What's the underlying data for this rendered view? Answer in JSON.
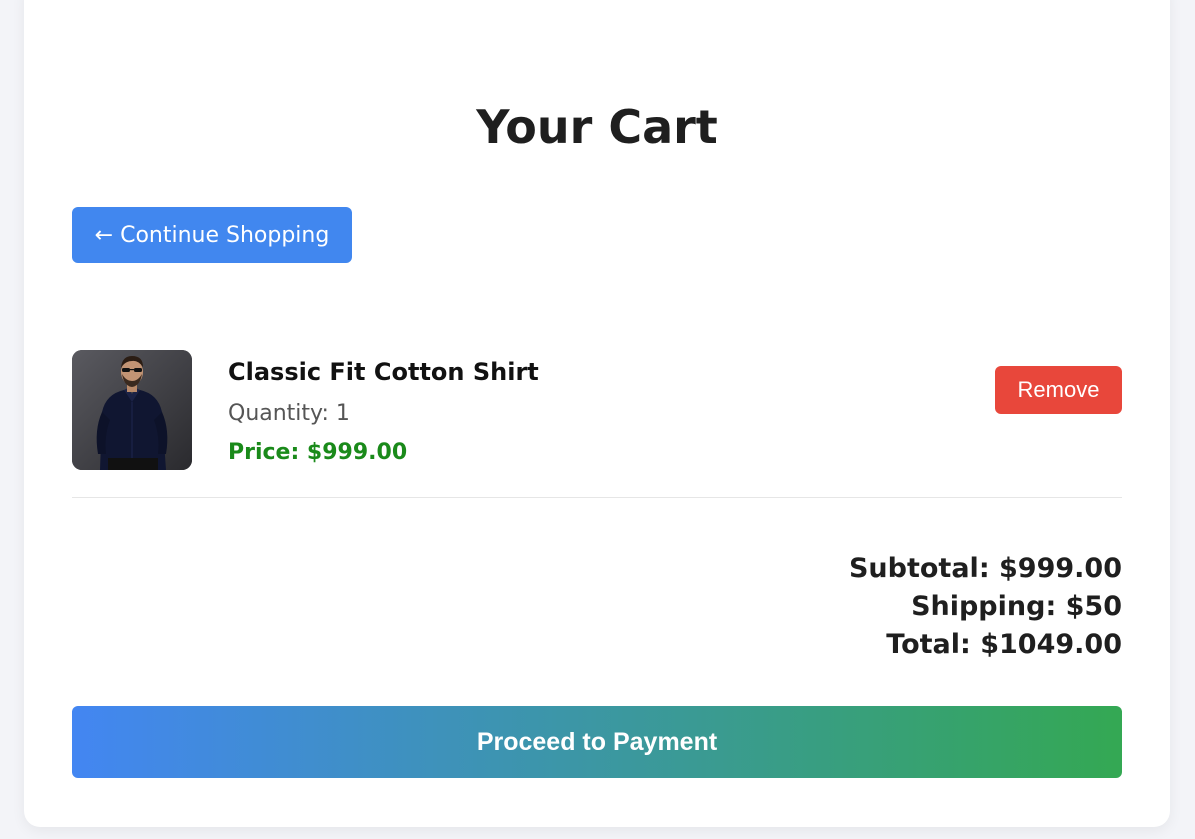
{
  "page": {
    "title": "Your Cart"
  },
  "actions": {
    "continue_shopping_label": "← Continue Shopping",
    "remove_label": "Remove",
    "proceed_label": "Proceed to Payment"
  },
  "cart": {
    "items": [
      {
        "name": "Classic Fit Cotton Shirt",
        "quantity_label": "Quantity:",
        "quantity": "1",
        "price_text": "Price: $999.00",
        "image": "product-photo-man-in-navy-shirt"
      }
    ]
  },
  "summary": {
    "subtotal": "Subtotal: $999.00",
    "shipping": "Shipping: $50",
    "total": "Total: $1049.00"
  },
  "colors": {
    "primary_button": "#4187ef",
    "remove_button": "#e8473b",
    "price_text": "#1a8a1a",
    "gradient_start": "#4386f2",
    "gradient_end": "#34a853"
  }
}
